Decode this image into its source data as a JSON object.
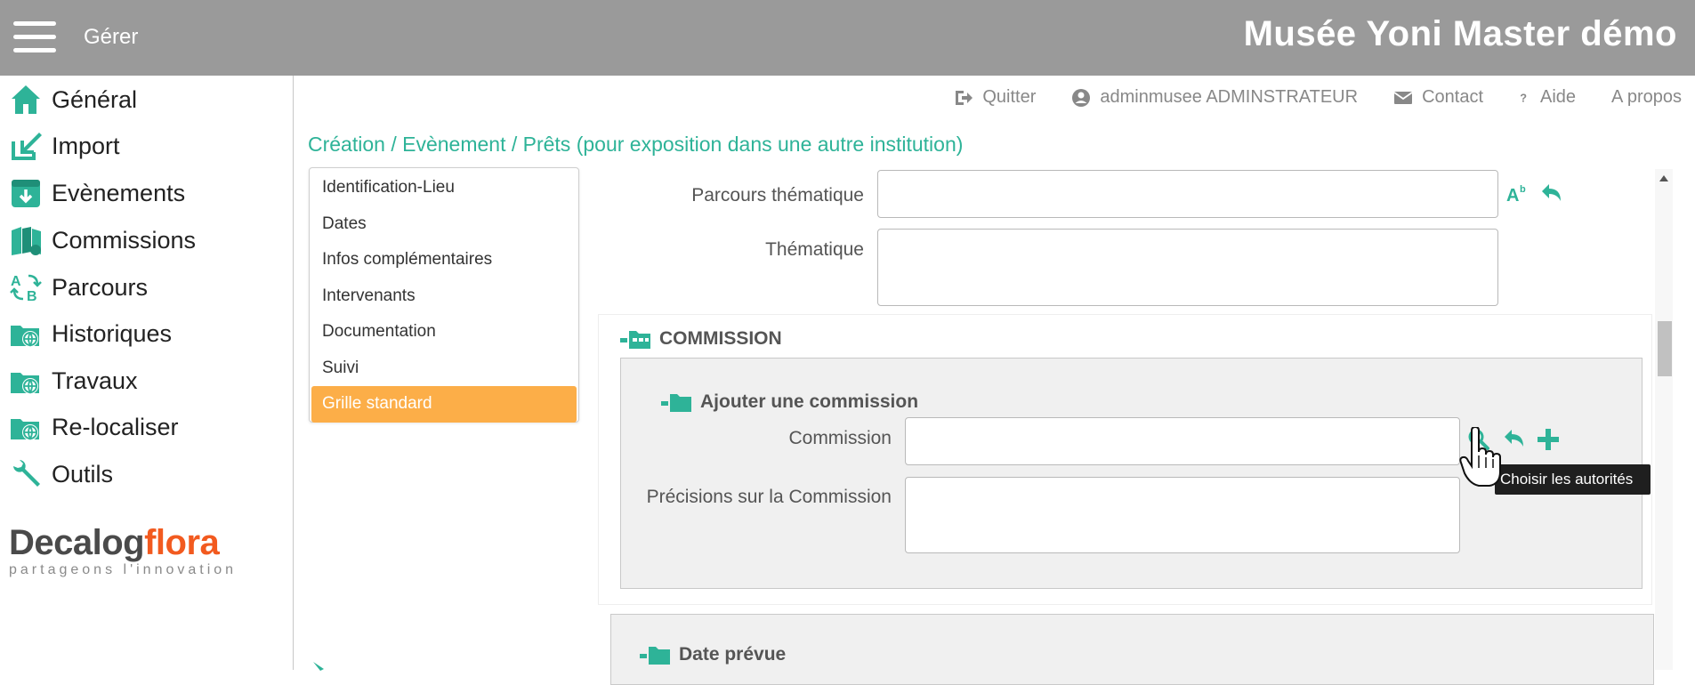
{
  "header": {
    "menu_label": "Gérer",
    "title": "Musée Yoni Master démo"
  },
  "sidebar": {
    "items": [
      {
        "label": "Général",
        "icon": "home-icon"
      },
      {
        "label": "Import",
        "icon": "import-icon"
      },
      {
        "label": "Evènements",
        "icon": "events-icon"
      },
      {
        "label": "Commissions",
        "icon": "commissions-icon"
      },
      {
        "label": "Parcours",
        "icon": "parcours-icon"
      },
      {
        "label": "Historiques",
        "icon": "historiques-icon"
      },
      {
        "label": "Travaux",
        "icon": "travaux-icon"
      },
      {
        "label": "Re-localiser",
        "icon": "relocaliser-icon"
      },
      {
        "label": "Outils",
        "icon": "wrench-icon"
      }
    ],
    "logo": {
      "brand": "Decalog",
      "product": "flora",
      "tagline": "partageons l'innovation"
    }
  },
  "toplinks": {
    "quit": "Quitter",
    "user": "adminmusee ADMINSTRATEUR",
    "contact": "Contact",
    "help": "Aide",
    "about": "A propos"
  },
  "breadcrumb": "Création / Evènement / Prêts (pour exposition dans une autre institution)",
  "tabs": {
    "items": [
      "Identification-Lieu",
      "Dates",
      "Infos complémentaires",
      "Intervenants",
      "Documentation",
      "Suivi",
      "Grille standard"
    ],
    "active": "Grille standard"
  },
  "form": {
    "parcours_label": "Parcours thématique",
    "parcours_value": "",
    "thematique_label": "Thématique",
    "thematique_value": "",
    "commission_section": "COMMISSION",
    "add_commission": "Ajouter une commission",
    "commission_label": "Commission",
    "commission_value": "",
    "precisions_label": "Précisions sur la Commission",
    "precisions_value": "",
    "date_section": "Date prévue"
  },
  "tooltip": "Choisir les autorités",
  "colors": {
    "header": "#9a9a9a",
    "accent": "#2eb398",
    "active_tab": "#fcae48",
    "logo_orange": "#f25a1f"
  }
}
